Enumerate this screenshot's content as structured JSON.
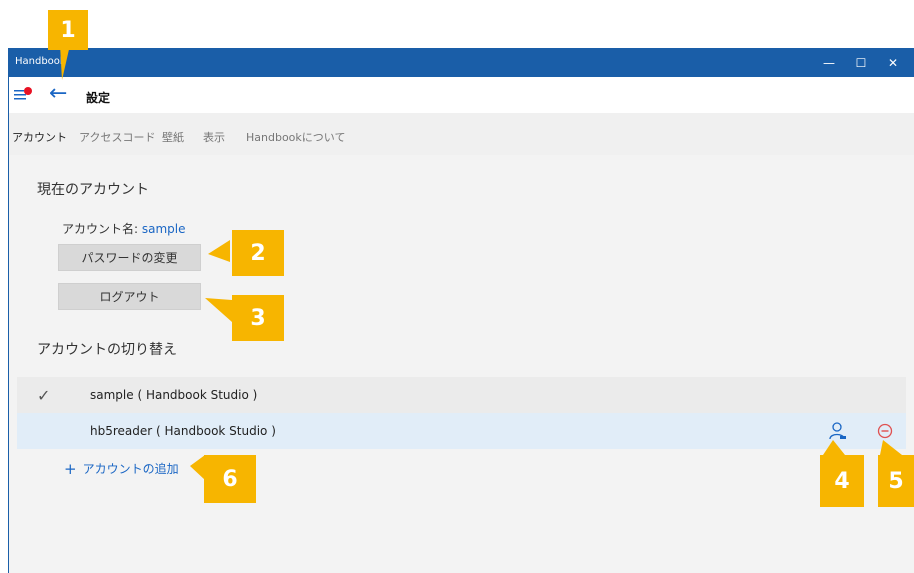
{
  "window": {
    "title": "Handbook",
    "controls": {
      "minimize": "—",
      "maximize": "☐",
      "close": "✕"
    }
  },
  "commandbar": {
    "page_title": "設定",
    "back_glyph": "←"
  },
  "tabs": [
    {
      "label": "アカウント",
      "active": true
    },
    {
      "label": "アクセスコード"
    },
    {
      "label": "壁紙"
    },
    {
      "label": "表示"
    },
    {
      "label": "Handbookについて"
    }
  ],
  "current_account": {
    "heading": "現在のアカウント",
    "name_label": "アカウント名: ",
    "name_value": "sample",
    "change_password_button": "パスワードの変更",
    "logout_button": "ログアウト"
  },
  "switch_account": {
    "heading": "アカウントの切り替え",
    "accounts": [
      {
        "label": "sample ( Handbook Studio )",
        "selected": true,
        "check_glyph": "✓"
      },
      {
        "label": "hb5reader ( Handbook Studio )",
        "selected": false
      }
    ],
    "add_account_plus": "+",
    "add_account": "アカウントの追加"
  },
  "callouts": [
    "1",
    "2",
    "3",
    "4",
    "5",
    "6"
  ],
  "colors": {
    "titlebar": "#1a5ea8",
    "accent": "#1a66c4",
    "callout": "#f7b500",
    "notification_dot": "#e81123",
    "remove_icon": "#e05050"
  }
}
